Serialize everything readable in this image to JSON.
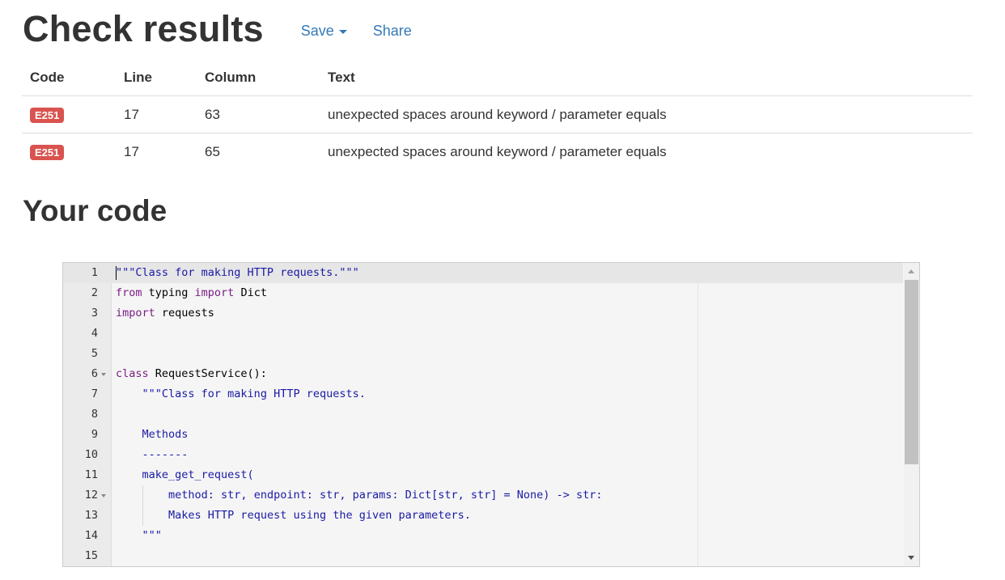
{
  "results": {
    "title": "Check results",
    "save_label": "Save",
    "share_label": "Share",
    "columns": [
      "Code",
      "Line",
      "Column",
      "Text"
    ],
    "rows": [
      {
        "code": "E251",
        "line": "17",
        "column": "63",
        "text": "unexpected spaces around keyword / parameter equals"
      },
      {
        "code": "E251",
        "line": "17",
        "column": "65",
        "text": "unexpected spaces around keyword / parameter equals"
      }
    ],
    "badge_color": "#d9534f"
  },
  "code_section": {
    "title": "Your code",
    "lines": [
      {
        "num": "1",
        "text": "\"\"\"Class for making HTTP requests.\"\"\""
      },
      {
        "num": "2",
        "text": "from typing import Dict"
      },
      {
        "num": "3",
        "text": "import requests"
      },
      {
        "num": "4",
        "text": ""
      },
      {
        "num": "5",
        "text": ""
      },
      {
        "num": "6",
        "text": "class RequestService():"
      },
      {
        "num": "7",
        "text": "    \"\"\"Class for making HTTP requests."
      },
      {
        "num": "8",
        "text": ""
      },
      {
        "num": "9",
        "text": "    Methods"
      },
      {
        "num": "10",
        "text": "    -------"
      },
      {
        "num": "11",
        "text": "    make_get_request("
      },
      {
        "num": "12",
        "text": "        method: str, endpoint: str, params: Dict[str, str] = None) -> str:"
      },
      {
        "num": "13",
        "text": "        Makes HTTP request using the given parameters."
      },
      {
        "num": "14",
        "text": "    \"\"\""
      },
      {
        "num": "15",
        "text": ""
      }
    ]
  },
  "colors": {
    "link": "#337ab7",
    "keyword": "#7a1e82",
    "string": "#1a1aa6"
  }
}
